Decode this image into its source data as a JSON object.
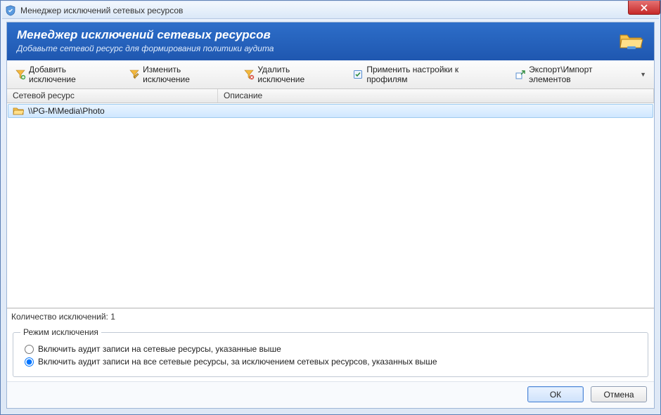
{
  "window": {
    "title": "Менеджер исключений сетевых ресурсов"
  },
  "header": {
    "title": "Менеджер исключений сетевых ресурсов",
    "subtitle": "Добавьте сетевой ресурс для формирования политики аудита"
  },
  "toolbar": {
    "add": "Добавить исключение",
    "edit": "Изменить исключение",
    "delete": "Удалить исключение",
    "apply": "Применить настройки к профилям",
    "export_import": "Экспорт\\Импорт элементов"
  },
  "grid": {
    "columns": {
      "resource": "Сетевой ресурс",
      "description": "Описание"
    },
    "rows": [
      {
        "resource": "\\\\PG-M\\Media\\Photo",
        "description": ""
      }
    ]
  },
  "count": {
    "label": "Количество исключений:",
    "value": "1"
  },
  "mode": {
    "legend": "Режим исключения",
    "opt_include": "Включить аудит записи на сетевые ресурсы, указанные выше",
    "opt_exclude": "Включить аудит записи на все сетевые ресурсы, за исключением сетевых ресурсов, указанных выше"
  },
  "footer": {
    "ok": "ОК",
    "cancel": "Отмена"
  }
}
